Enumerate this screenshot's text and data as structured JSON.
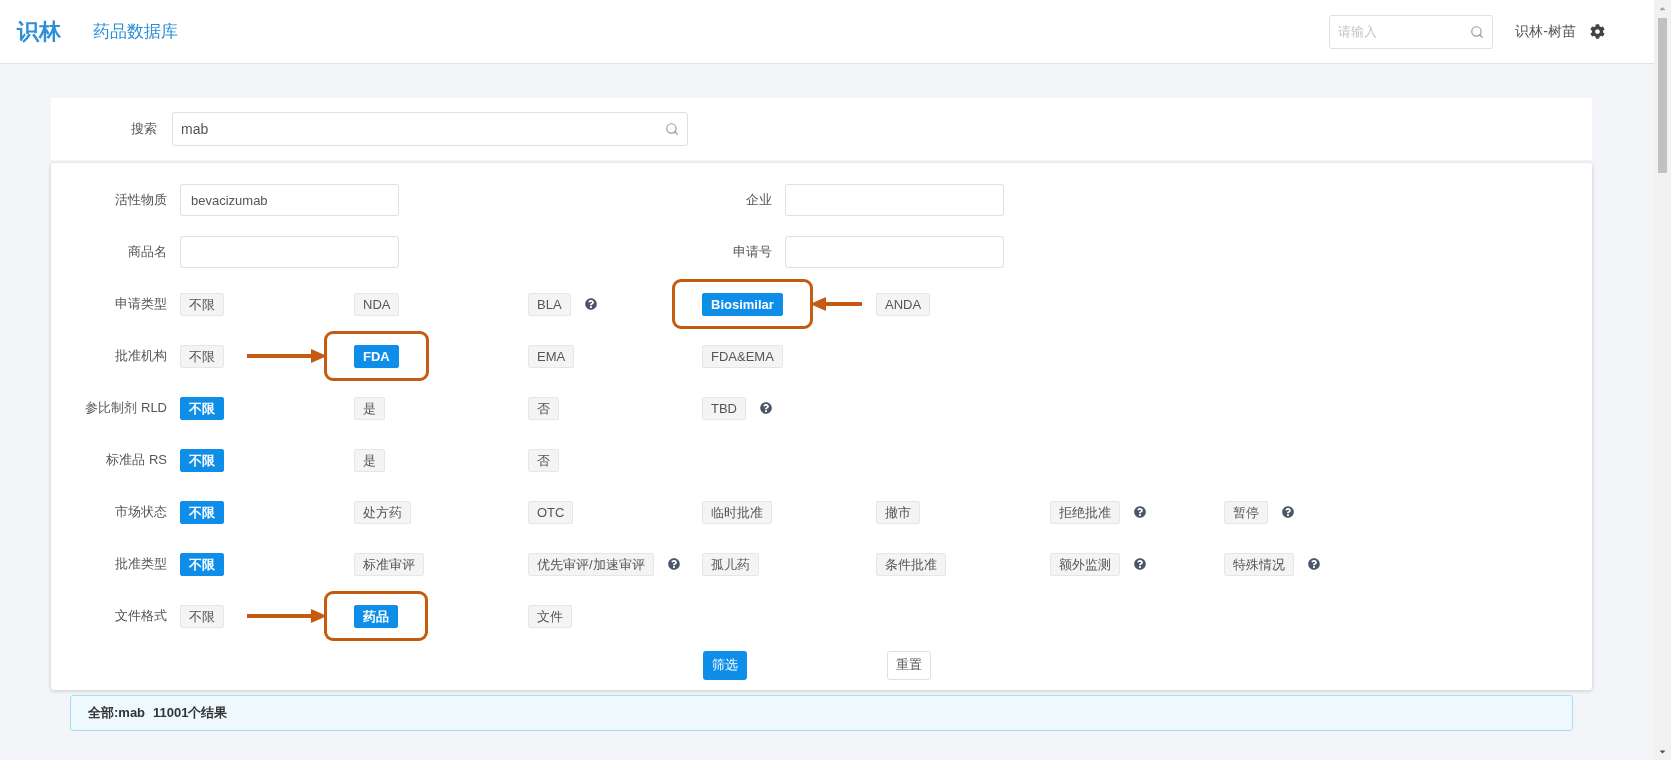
{
  "header": {
    "logo": "识林",
    "title": "药品数据库",
    "search": {
      "placeholder": "请输入"
    },
    "user": "识林-树苗"
  },
  "search": {
    "label": "搜索",
    "value": "mab"
  },
  "filters": [
    {
      "kind": "fields",
      "fields": [
        {
          "label": "活性物质",
          "value": "bevacizumab"
        },
        {
          "label": "企业"
        }
      ]
    },
    {
      "kind": "fields",
      "fields": [
        {
          "label": "商品名"
        },
        {
          "label": "申请号"
        }
      ]
    },
    {
      "kind": "chips",
      "label": "申请类型",
      "options": [
        {
          "label": "不限",
          "selected": false
        },
        {
          "label": "NDA",
          "selected": false
        },
        {
          "label": "BLA",
          "selected": false,
          "help": true
        },
        {
          "label": "Biosimilar",
          "selected": true,
          "callout": true,
          "arrow_from_left": false
        },
        {
          "label": "ANDA",
          "selected": false
        }
      ]
    },
    {
      "kind": "chips",
      "label": "批准机构",
      "options": [
        {
          "label": "不限",
          "selected": false
        },
        {
          "label": "FDA",
          "selected": true,
          "callout": true,
          "arrow_from_left": true
        },
        {
          "label": "EMA",
          "selected": false
        },
        {
          "label": "FDA&EMA",
          "selected": false
        }
      ]
    },
    {
      "kind": "chips",
      "label": "参比制剂 RLD",
      "options": [
        {
          "label": "不限",
          "selected": true
        },
        {
          "label": "是",
          "selected": false
        },
        {
          "label": "否",
          "selected": false
        },
        {
          "label": "TBD",
          "selected": false,
          "help": true
        }
      ]
    },
    {
      "kind": "chips",
      "label": "标准品 RS",
      "options": [
        {
          "label": "不限",
          "selected": true
        },
        {
          "label": "是",
          "selected": false
        },
        {
          "label": "否",
          "selected": false
        }
      ]
    },
    {
      "kind": "chips",
      "label": "市场状态",
      "options": [
        {
          "label": "不限",
          "selected": true
        },
        {
          "label": "处方药",
          "selected": false
        },
        {
          "label": "OTC",
          "selected": false
        },
        {
          "label": "临时批准",
          "selected": false
        },
        {
          "label": "撤市",
          "selected": false
        },
        {
          "label": "拒绝批准",
          "selected": false,
          "help": true
        },
        {
          "label": "暂停",
          "selected": false,
          "help": true
        }
      ]
    },
    {
      "kind": "chips",
      "label": "批准类型",
      "options": [
        {
          "label": "不限",
          "selected": true
        },
        {
          "label": "标准审评",
          "selected": false
        },
        {
          "label": "优先审评/加速审评",
          "selected": false,
          "help": true
        },
        {
          "label": "孤儿药",
          "selected": false
        },
        {
          "label": "条件批准",
          "selected": false
        },
        {
          "label": "额外监测",
          "selected": false,
          "help": true
        },
        {
          "label": "特殊情况",
          "selected": false,
          "help": true
        }
      ]
    },
    {
      "kind": "chips",
      "label": "文件格式",
      "options": [
        {
          "label": "不限",
          "selected": false
        },
        {
          "label": "药品",
          "selected": true,
          "callout": true,
          "arrow_from_left": true
        },
        {
          "label": "文件",
          "selected": false
        }
      ]
    }
  ],
  "actions": {
    "filter": "筛选",
    "reset": "重置"
  },
  "result": {
    "scope": "全部:mab",
    "count": "11001个结果"
  }
}
